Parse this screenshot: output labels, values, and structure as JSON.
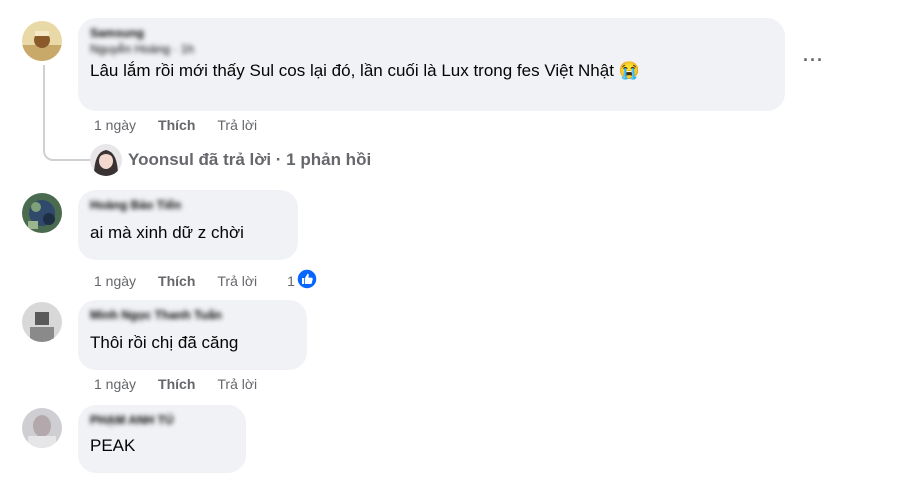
{
  "comments": [
    {
      "author": "Samsung",
      "meta": "Nguyễn Hoàng · 1h",
      "text": "Lâu lắm rồi mới thấy Sul cos lại đó, lần cuối là Lux trong fes Việt Nhật",
      "emoji": "😭",
      "age": "1 ngày",
      "like_label": "Thích",
      "reply_label": "Trả lời",
      "replies_summary": {
        "replier": "Yoonsul",
        "text": "Yoonsul đã trả lời · 1 phản hồi"
      }
    },
    {
      "author": "Hoàng Bảo Tiến",
      "text": "ai mà xinh dữ z chời",
      "age": "1 ngày",
      "like_label": "Thích",
      "reply_label": "Trả lời",
      "reaction_count": "1"
    },
    {
      "author": "Minh Ngọc Thanh Tuấn",
      "text": "Thôi rồi chị đã căng",
      "age": "1 ngày",
      "like_label": "Thích",
      "reply_label": "Trả lời"
    },
    {
      "author": "PHẠM ANH TÚ",
      "text": "PEAK"
    }
  ],
  "more_options_icon": "more-horizontal-icon",
  "like_reaction_icon": "thumbs-up-icon",
  "colors": {
    "bubble": "#f0f2f5",
    "secondary_text": "#65676b",
    "like_blue": "#0866ff"
  }
}
